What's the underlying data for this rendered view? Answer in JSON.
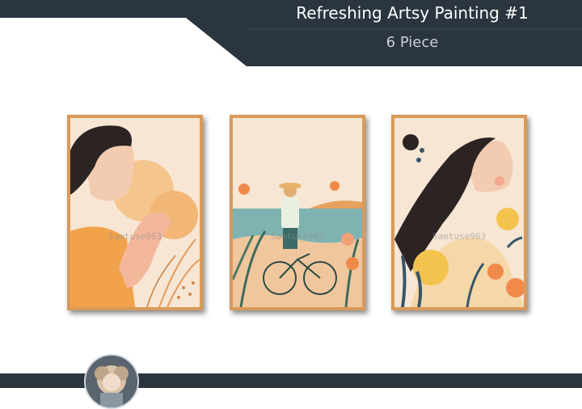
{
  "header": {
    "title": "Refreshing Artsy Painting #1",
    "subtitle": "6 Piece"
  },
  "paintings": [
    {
      "watermark": "Samtuse963"
    },
    {
      "watermark": "Samtuse963"
    },
    {
      "watermark": "Samtuse963"
    }
  ],
  "colors": {
    "banner": "#2a3540",
    "frame": "#d99a5a",
    "canvas": "#f6e6d3",
    "accent_orange": "#f2a24a",
    "accent_teal": "#6aa8a6",
    "dark_hair": "#2b2422"
  }
}
